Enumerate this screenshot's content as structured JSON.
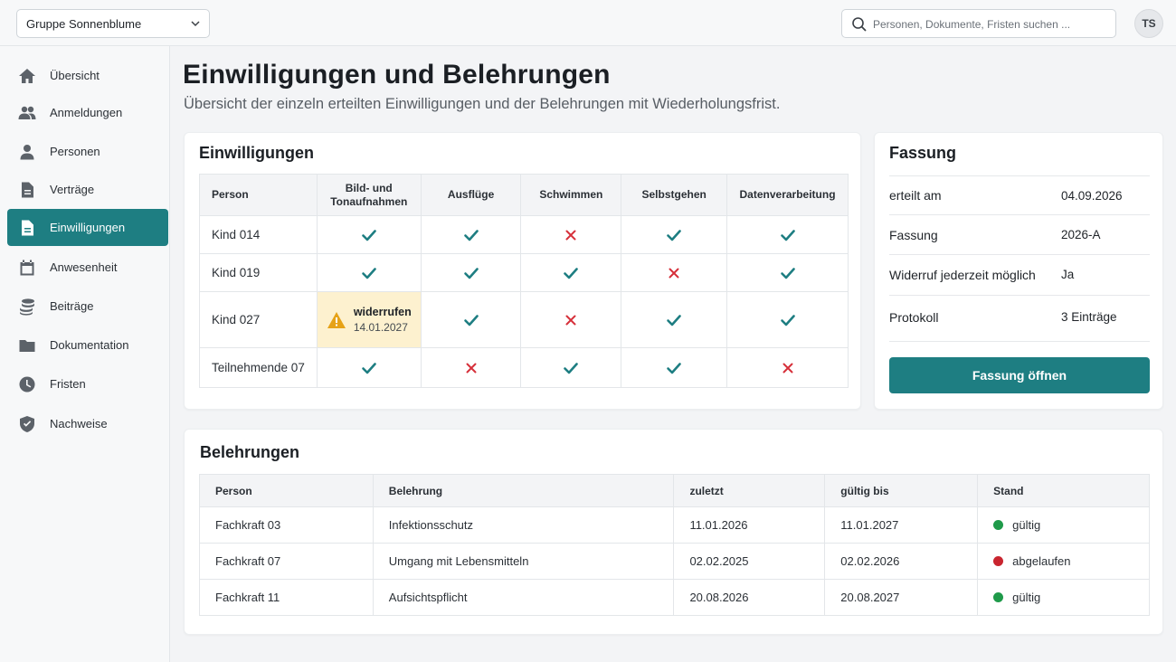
{
  "header": {
    "group_select": "Gruppe Sonnenblume",
    "search_placeholder": "Personen, Dokumente, Fristen suchen ...",
    "avatar_initials": "TS"
  },
  "sidebar": {
    "items": [
      {
        "label": "Übersicht",
        "icon": "home-icon"
      },
      {
        "label": "Anmeldungen",
        "icon": "users-icon"
      },
      {
        "label": "Personen",
        "icon": "person-icon"
      },
      {
        "label": "Verträge",
        "icon": "document-icon"
      },
      {
        "label": "Einwilligungen",
        "icon": "document-icon",
        "active": true
      },
      {
        "label": "Anwesenheit",
        "icon": "calendar-icon"
      },
      {
        "label": "Beiträge",
        "icon": "coins-icon"
      },
      {
        "label": "Dokumentation",
        "icon": "folder-icon"
      },
      {
        "label": "Fristen",
        "icon": "clock-icon"
      },
      {
        "label": "Nachweise",
        "icon": "shield-check-icon"
      }
    ]
  },
  "page": {
    "title": "Einwilligungen und Belehrungen",
    "subtitle": "Übersicht der einzeln erteilten Einwilligungen und der Belehrungen mit Wiederholungsfrist."
  },
  "consents": {
    "title": "Einwilligungen",
    "columns": [
      "Person",
      "Bild- und Tonaufnahmen",
      "Ausflüge",
      "Schwimmen",
      "Selbstgehen",
      "Datenverarbeitung"
    ],
    "rows": [
      {
        "person": "Kind 014",
        "cells": [
          "yes",
          "yes",
          "no",
          "yes",
          "yes"
        ]
      },
      {
        "person": "Kind 019",
        "cells": [
          "yes",
          "yes",
          "yes",
          "no",
          "yes"
        ]
      },
      {
        "person": "Kind 027",
        "cells": [
          "revoked",
          "yes",
          "no",
          "yes",
          "yes"
        ]
      },
      {
        "person": "Teilnehmende 07",
        "cells": [
          "yes",
          "no",
          "yes",
          "yes",
          "no"
        ]
      }
    ],
    "revoked_label": "widerrufen",
    "revoked_date": "14.01.2027"
  },
  "fassung": {
    "title": "Fassung",
    "rows": [
      {
        "key": "erteilt am",
        "value": "04.09.2026"
      },
      {
        "key": "Fassung",
        "value": "2026-A"
      },
      {
        "key": "Widerruf jederzeit möglich",
        "value": "Ja"
      },
      {
        "key": "Protokoll",
        "value": "3 Einträge"
      }
    ],
    "button_label": "Fassung öffnen"
  },
  "instructions": {
    "title": "Belehrungen",
    "columns": [
      "Person",
      "Belehrung",
      "zuletzt",
      "gültig bis",
      "Stand"
    ],
    "rows": [
      {
        "person": "Fachkraft 03",
        "belehrung": "Infektionsschutz",
        "zuletzt": "11.01.2026",
        "gueltig_bis": "11.01.2027",
        "stand": "gültig",
        "status": "ok"
      },
      {
        "person": "Fachkraft 07",
        "belehrung": "Umgang mit Lebensmitteln",
        "zuletzt": "02.02.2025",
        "gueltig_bis": "02.02.2026",
        "stand": "abgelaufen",
        "status": "expired"
      },
      {
        "person": "Fachkraft 11",
        "belehrung": "Aufsichtspflicht",
        "zuletzt": "20.08.2026",
        "gueltig_bis": "20.08.2027",
        "stand": "gültig",
        "status": "ok"
      }
    ]
  },
  "colors": {
    "accent": "#1e7e82",
    "check": "#1e7e82",
    "cross": "#d6303a",
    "warning": "#e6a217",
    "status_ok": "#1f9a4a",
    "status_expired": "#c9252f"
  }
}
